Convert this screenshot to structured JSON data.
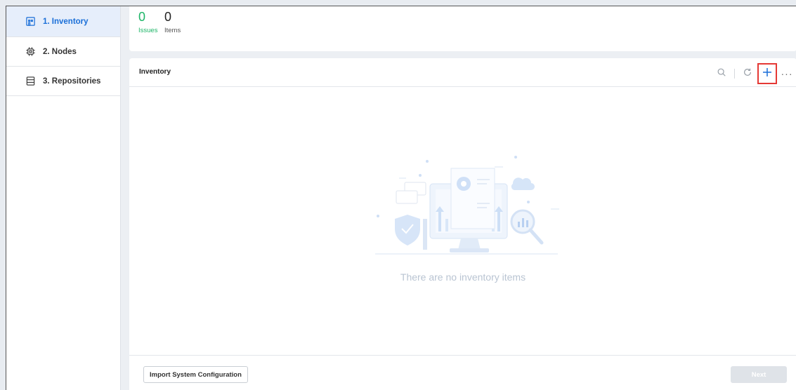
{
  "sidebar": {
    "items": [
      {
        "label": "1. Inventory",
        "icon": "building-icon",
        "active": true
      },
      {
        "label": "2. Nodes",
        "icon": "chip-icon",
        "active": false
      },
      {
        "label": "3. Repositories",
        "icon": "database-icon",
        "active": false
      }
    ]
  },
  "summary": {
    "issues_count": "0",
    "issues_label": "Issues",
    "items_count": "0",
    "items_label": "Items"
  },
  "panel": {
    "title": "Inventory",
    "toolbar": {
      "search_icon": "search-icon",
      "refresh_icon": "refresh-icon",
      "add_icon": "plus-icon",
      "more_label": "···"
    },
    "empty_message": "There are no inventory items",
    "footer": {
      "import_label": "Import System Configuration",
      "next_label": "Next"
    }
  },
  "colors": {
    "accent": "#1a6fd8",
    "issues_green": "#1db567",
    "highlight_red": "#e53935",
    "empty_text": "#b9c4d2"
  }
}
